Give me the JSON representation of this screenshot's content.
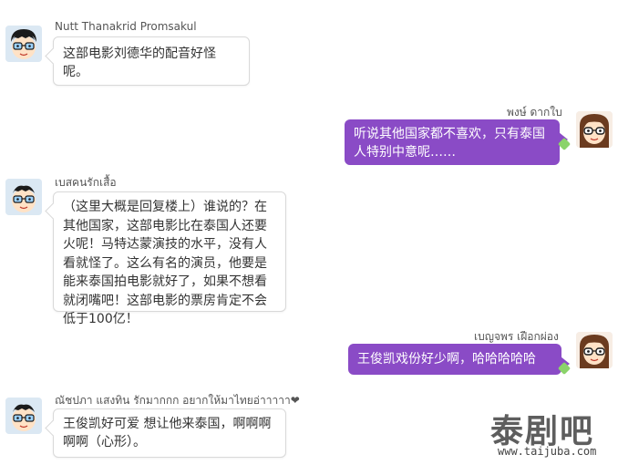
{
  "messages": [
    {
      "side": "left",
      "avatar": "boy-glasses-icon",
      "name": "Nutt Thanakrid Promsakul",
      "text": "这部电影刘德华的配音好怪呢。"
    },
    {
      "side": "right",
      "avatar": "girl-glasses-icon",
      "name": "พงษ์ ดากใบ",
      "text": "听说其他国家都不喜欢，只有泰国人特别中意呢……"
    },
    {
      "side": "left",
      "avatar": "boy-glasses-icon",
      "name": "เบสคนรักเสื้อ",
      "text": "（这里大概是回复楼上）谁说的？在其他国家，这部电影比在泰国人还要火呢！马特达蒙演技的水平，没有人看就怪了。这么有名的演员，他要是能来泰国拍电影就好了，如果不想看就闭嘴吧！这部电影的票房肯定不会低于100亿！"
    },
    {
      "side": "right",
      "avatar": "girl-glasses-icon",
      "name": "เบญจพร เฝือกผ่อง",
      "text": "王俊凯戏份好少啊，哈哈哈哈哈~~"
    },
    {
      "side": "left",
      "avatar": "boy-glasses-icon",
      "name": "ณัชปภา แสงทิน รักมากกก อยากให้มาไทยอ่าาาาา❤",
      "text": "王俊凯好可爱 想让他来泰国，啊啊啊啊啊（心形）。"
    }
  ],
  "watermark": {
    "cn": "泰剧吧",
    "url": "www.taijuba.com"
  },
  "colors": {
    "right_bubble": "#8a4bc6",
    "left_bubble_border": "#d9d9d9",
    "tail_accent": "#8bd36a"
  }
}
